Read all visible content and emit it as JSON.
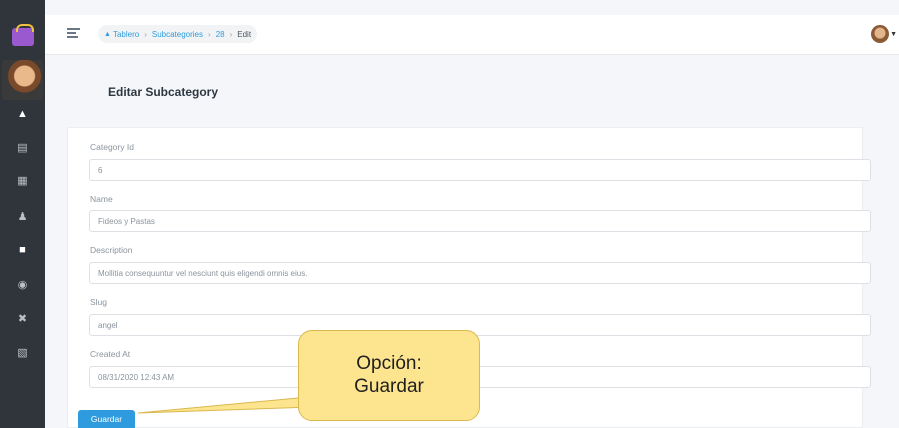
{
  "breadcrumb": {
    "home": "Tablero",
    "items": [
      "Subcategories",
      "28"
    ],
    "current": "Edit"
  },
  "page": {
    "title": "Editar Subcategory"
  },
  "form": {
    "fields": [
      {
        "label": "Category Id",
        "value": "6"
      },
      {
        "label": "Name",
        "value": "Fideos y Pastas"
      },
      {
        "label": "Description",
        "value": "Mollitia consequuntur vel nesciunt quis eligendi omnis eius."
      },
      {
        "label": "Slug",
        "value": "angel"
      },
      {
        "label": "Created At",
        "value": "08/31/2020 12:43 AM"
      }
    ],
    "save_label": "Guardar"
  },
  "callout": {
    "line1": "Opción:",
    "line2": "Guardar"
  },
  "sidebar": {
    "icons": [
      "home-icon",
      "inbox-icon",
      "store-icon",
      "users-icon",
      "book-icon",
      "location-pin-icon",
      "tools-icon",
      "trash-icon"
    ]
  },
  "colors": {
    "primary": "#2e9bde",
    "sidebar": "#2f353a",
    "callout": "#fde58f"
  }
}
